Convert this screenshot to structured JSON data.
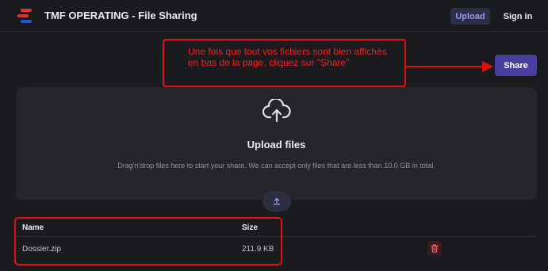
{
  "header": {
    "app_title": "TMF OPERATING - File Sharing",
    "nav": {
      "upload_label": "Upload",
      "signin_label": "Sign in"
    }
  },
  "annotation": {
    "text": "Une fois que tout vos fichiers sont bien affichés en bas de la page, cliquez sur \"Share\"",
    "color": "#e01010"
  },
  "share_button": {
    "label": "Share",
    "color": "#4a3f9e"
  },
  "dropzone": {
    "title": "Upload files",
    "description": "Drag'n'drop files here to start your share. We can accept only files that are less than 10.0 GB in total.",
    "icon": "cloud-upload-icon"
  },
  "table": {
    "columns": [
      "Name",
      "Size"
    ],
    "rows": [
      {
        "name": "Dossier.zip",
        "size": "211.9 KB"
      }
    ]
  },
  "icons": {
    "logo": "logo-icon",
    "upload": "upload-icon",
    "delete": "trash-icon"
  }
}
